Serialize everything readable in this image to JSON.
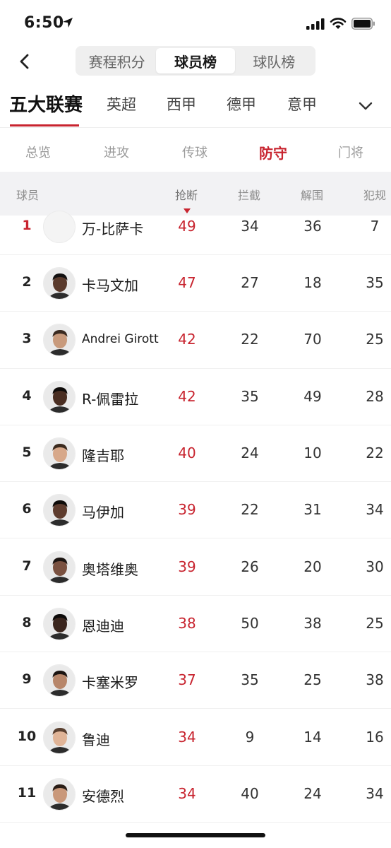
{
  "status": {
    "time": "6:50"
  },
  "nav": {
    "segments": [
      {
        "label": "赛程积分",
        "active": false
      },
      {
        "label": "球员榜",
        "active": true
      },
      {
        "label": "球队榜",
        "active": false
      }
    ]
  },
  "leagues": {
    "active_label": "五大联赛",
    "others": [
      "英超",
      "西甲",
      "德甲",
      "意甲"
    ]
  },
  "subtabs": {
    "items": [
      "总览",
      "进攻",
      "传球",
      "防守",
      "门将"
    ],
    "active_index": 3
  },
  "table": {
    "headers": {
      "player": "球员",
      "tackles": "抢断",
      "interceptions": "拦截",
      "clearances": "解围",
      "fouls": "犯规"
    },
    "sorted_by": "tackles",
    "rows": [
      {
        "rank": "1",
        "name": "万-比萨卡",
        "tackles": "49",
        "interceptions": "34",
        "clearances": "36",
        "fouls": "7"
      },
      {
        "rank": "2",
        "name": "卡马文加",
        "tackles": "47",
        "interceptions": "27",
        "clearances": "18",
        "fouls": "35"
      },
      {
        "rank": "3",
        "name": "Andrei Girott",
        "tackles": "42",
        "interceptions": "22",
        "clearances": "70",
        "fouls": "25"
      },
      {
        "rank": "4",
        "name": "R-佩雷拉",
        "tackles": "42",
        "interceptions": "35",
        "clearances": "49",
        "fouls": "28"
      },
      {
        "rank": "5",
        "name": "隆吉耶",
        "tackles": "40",
        "interceptions": "24",
        "clearances": "10",
        "fouls": "22"
      },
      {
        "rank": "6",
        "name": "马伊加",
        "tackles": "39",
        "interceptions": "22",
        "clearances": "31",
        "fouls": "34"
      },
      {
        "rank": "7",
        "name": "奥塔维奥",
        "tackles": "39",
        "interceptions": "26",
        "clearances": "20",
        "fouls": "30"
      },
      {
        "rank": "8",
        "name": "恩迪迪",
        "tackles": "38",
        "interceptions": "50",
        "clearances": "38",
        "fouls": "25"
      },
      {
        "rank": "9",
        "name": "卡塞米罗",
        "tackles": "37",
        "interceptions": "35",
        "clearances": "25",
        "fouls": "38"
      },
      {
        "rank": "10",
        "name": "鲁迪",
        "tackles": "34",
        "interceptions": "9",
        "clearances": "14",
        "fouls": "16"
      },
      {
        "rank": "11",
        "name": "安德烈",
        "tackles": "34",
        "interceptions": "40",
        "clearances": "24",
        "fouls": "34"
      }
    ]
  },
  "colors": {
    "accent": "#c8242f",
    "header_bg": "#f2f2f4",
    "segment_bg": "#efefef"
  },
  "icons": [
    "location-arrow-icon",
    "signal-icon",
    "wifi-icon",
    "battery-icon",
    "back-chevron-icon",
    "chevron-down-icon",
    "sort-desc-icon",
    "player-avatar"
  ]
}
